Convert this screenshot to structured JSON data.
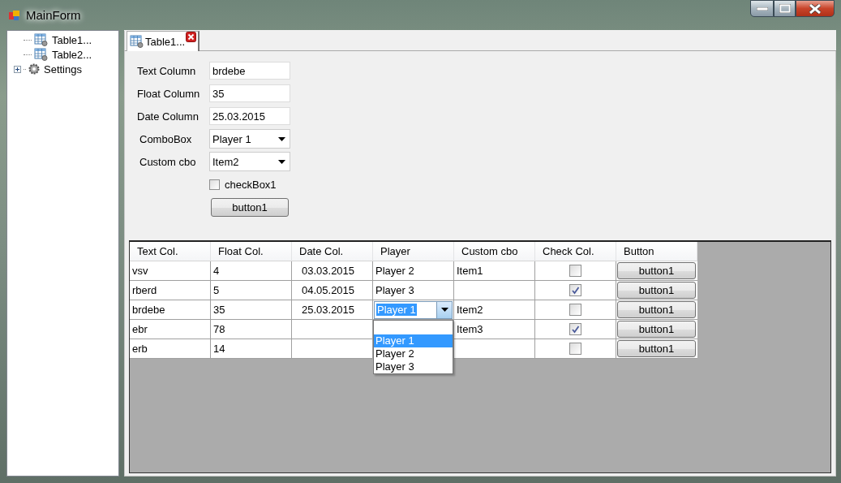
{
  "window": {
    "title": "MainForm"
  },
  "tree": {
    "items": [
      {
        "kind": "table",
        "label": "Table1..."
      },
      {
        "kind": "table",
        "label": "Table2..."
      },
      {
        "kind": "settings",
        "label": "Settings",
        "expanded": false
      }
    ]
  },
  "tabs": [
    {
      "label": "Table1...",
      "selected": true
    }
  ],
  "form": {
    "fields": [
      {
        "kind": "text",
        "label": "Text Column",
        "value": "brdebe"
      },
      {
        "kind": "text",
        "label": "Float Column",
        "value": "35"
      },
      {
        "kind": "text",
        "label": "Date Column",
        "value": "25.03.2015"
      },
      {
        "kind": "combo",
        "label": "ComboBox",
        "value": "Player 1"
      },
      {
        "kind": "combo",
        "label": "Custom cbo",
        "value": "Item2"
      }
    ],
    "checkbox": {
      "label": "checkBox1",
      "checked": false
    },
    "button": "button1"
  },
  "grid": {
    "columns": [
      "Text Col.",
      "Float Col.",
      "Date Col.",
      "Player",
      "Custom cbo",
      "Check Col.",
      "Button"
    ],
    "rows": [
      {
        "text": "vsv",
        "float": "4",
        "date": "03.03.2015",
        "player": "Player 2",
        "custom": "Item1",
        "checked": false,
        "button": "button1"
      },
      {
        "text": "rberd",
        "float": "5",
        "date": "04.05.2015",
        "player": "Player 3",
        "checked": true,
        "button": "button1"
      },
      {
        "text": "brdebe",
        "float": "35",
        "date": "25.03.2015",
        "player": "Player 1",
        "custom": "Item2",
        "checked": false,
        "button": "button1",
        "editing": true
      },
      {
        "text": "ebr",
        "float": "78",
        "custom": "Item3",
        "checked": true,
        "button": "button1"
      },
      {
        "text": "erb",
        "float": "14",
        "checked": false,
        "button": "button1"
      }
    ],
    "dropdown": {
      "options": [
        {
          "label": "Player 1",
          "selected": true
        },
        {
          "label": "Player 2",
          "selected": false
        },
        {
          "label": "Player 3",
          "selected": false
        }
      ]
    }
  }
}
